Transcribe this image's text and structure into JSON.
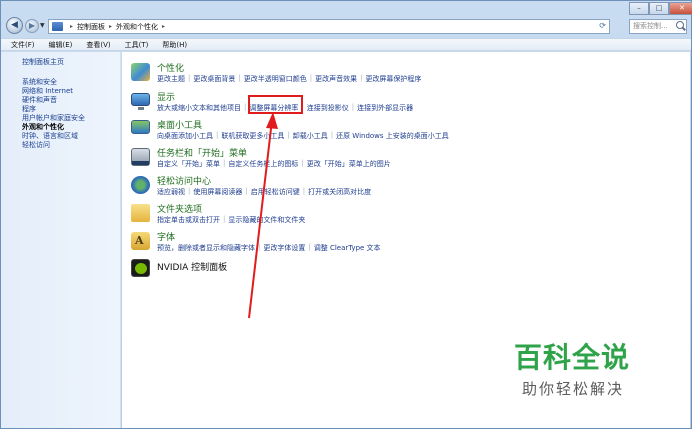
{
  "address_bar": {
    "crumbs": [
      "控制面板",
      "外观和个性化"
    ],
    "separator": "▸"
  },
  "search": {
    "placeholder": "搜索控制..."
  },
  "window_buttons": {
    "minimize": "–",
    "maximize": "□",
    "close": "✕"
  },
  "menu": [
    "文件(F)",
    "编辑(E)",
    "查看(V)",
    "工具(T)",
    "帮助(H)"
  ],
  "sidebar": {
    "home": "控制面板主页",
    "items": [
      "系统和安全",
      "网络和 Internet",
      "硬件和声音",
      "程序",
      "用户帐户和家庭安全",
      "外观和个性化",
      "时钟、语言和区域",
      "轻松访问"
    ],
    "current_index": 5
  },
  "categories": [
    {
      "title": "个性化",
      "links": [
        "更改主题",
        "更改桌面背景",
        "更改半透明窗口颜色",
        "更改声音效果",
        "更改屏幕保护程序"
      ]
    },
    {
      "title": "显示",
      "links": [
        "放大或缩小文本和其他项目",
        "调整屏幕分辨率",
        "连接到投影仪",
        "连接到外部显示器"
      ]
    },
    {
      "title": "桌面小工具",
      "links": [
        "向桌面添加小工具",
        "联机获取更多小工具",
        "卸载小工具",
        "还原 Windows 上安装的桌面小工具"
      ]
    },
    {
      "title": "任务栏和「开始」菜单",
      "links": [
        "自定义「开始」菜单",
        "自定义任务栏上的图标",
        "更改「开始」菜单上的图片"
      ]
    },
    {
      "title": "轻松访问中心",
      "links": [
        "适应弱视",
        "使用屏幕阅读器",
        "启用轻松访问键",
        "打开或关闭高对比度"
      ]
    },
    {
      "title": "文件夹选项",
      "links": [
        "指定单击或双击打开",
        "显示隐藏的文件和文件夹"
      ]
    },
    {
      "title": "字体",
      "links": [
        "预览，删除或者显示和隐藏字体",
        "更改字体设置",
        "调整 ClearType 文本"
      ]
    },
    {
      "title": "NVIDIA 控制面板",
      "links": []
    }
  ],
  "watermark": {
    "title": "百科全说",
    "subtitle": "助你轻松解决"
  },
  "colors": {
    "annotation": "#e11c1c",
    "category_title": "#1f6e1f",
    "link": "#1e3d8f"
  }
}
